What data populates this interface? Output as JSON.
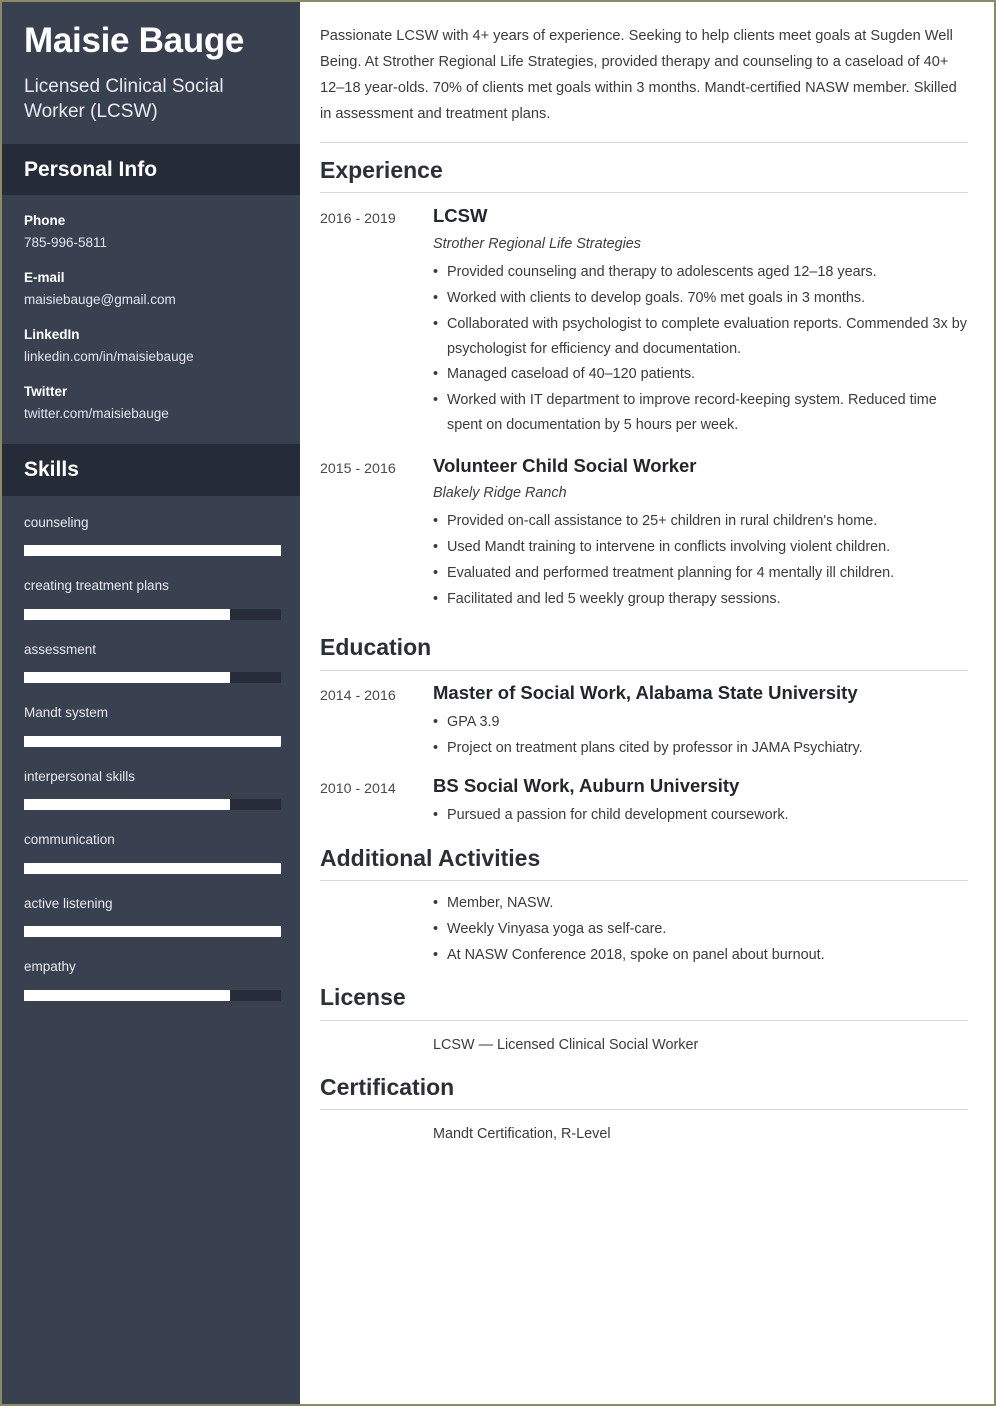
{
  "sidebar": {
    "name": "Maisie Bauge",
    "job_title": "Licensed Clinical Social Worker (LCSW)",
    "personal_info_heading": "Personal Info",
    "contacts": [
      {
        "label": "Phone",
        "value": "785-996-5811"
      },
      {
        "label": "E-mail",
        "value": "maisiebauge@gmail.com"
      },
      {
        "label": "LinkedIn",
        "value": "linkedin.com/in/maisiebauge"
      },
      {
        "label": "Twitter",
        "value": "twitter.com/maisiebauge"
      }
    ],
    "skills_heading": "Skills",
    "skills": [
      {
        "name": "counseling",
        "level": 100
      },
      {
        "name": "creating treatment plans",
        "level": 80
      },
      {
        "name": "assessment",
        "level": 80
      },
      {
        "name": "Mandt system",
        "level": 100
      },
      {
        "name": "interpersonal skills",
        "level": 80
      },
      {
        "name": "communication",
        "level": 100
      },
      {
        "name": "active listening",
        "level": 100
      },
      {
        "name": "empathy",
        "level": 80
      }
    ]
  },
  "main": {
    "summary": "Passionate LCSW with 4+ years of experience. Seeking to help clients meet goals at Sugden Well Being. At Strother Regional Life Strategies, provided therapy and counseling to a caseload of 40+ 12–18 year-olds. 70% of clients met goals within 3 months. Mandt-certified NASW member. Skilled in assessment and treatment plans.",
    "experience": {
      "heading": "Experience",
      "entries": [
        {
          "dates": "2016 - 2019",
          "role": "LCSW",
          "org": "Strother Regional Life Strategies",
          "bullets": [
            "Provided counseling and therapy to adolescents aged 12–18 years.",
            "Worked with clients to develop goals. 70% met goals in 3 months.",
            "Collaborated with psychologist to complete evaluation reports. Commended 3x by psychologist for efficiency and documentation.",
            "Managed caseload of 40–120 patients.",
            "Worked with IT department to improve record-keeping system. Reduced time spent on documentation by 5 hours per week."
          ]
        },
        {
          "dates": "2015 - 2016",
          "role": "Volunteer Child Social Worker",
          "org": "Blakely Ridge Ranch",
          "bullets": [
            "Provided on-call assistance to 25+ children in rural children's home.",
            "Used Mandt training to intervene in conflicts involving violent children.",
            "Evaluated and performed treatment planning for 4 mentally ill children.",
            "Facilitated and led 5 weekly group therapy sessions."
          ]
        }
      ]
    },
    "education": {
      "heading": "Education",
      "entries": [
        {
          "dates": "2014 - 2016",
          "role": "Master of Social Work, Alabama State University",
          "bullets": [
            "GPA 3.9",
            "Project on treatment plans cited by professor in JAMA Psychiatry."
          ]
        },
        {
          "dates": "2010 - 2014",
          "role": "BS Social Work, Auburn University",
          "bullets": [
            "Pursued a passion for child development coursework."
          ]
        }
      ]
    },
    "activities": {
      "heading": "Additional Activities",
      "bullets": [
        "Member, NASW.",
        "Weekly Vinyasa yoga as self-care.",
        "At NASW Conference 2018, spoke on panel about burnout."
      ]
    },
    "license": {
      "heading": "License",
      "text": "LCSW — Licensed Clinical Social Worker"
    },
    "certification": {
      "heading": "Certification",
      "text": "Mandt Certification, R-Level"
    }
  }
}
